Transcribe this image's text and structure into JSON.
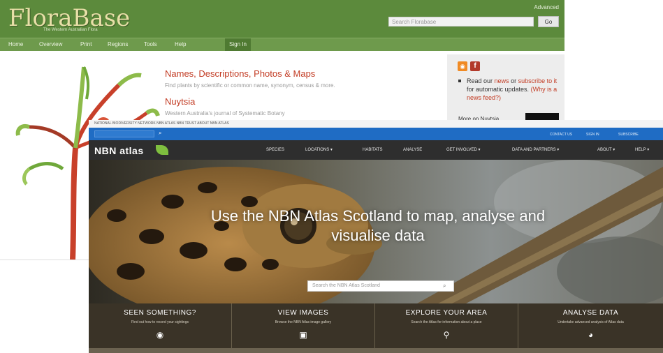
{
  "florabase": {
    "logo": "FloraBase",
    "tagline": "The Western Australian Flora",
    "advanced_label": "Advanced",
    "search_placeholder": "Search Florabase",
    "go_label": "Go",
    "nav": [
      "Home",
      "Overview",
      "Print",
      "Regions",
      "Tools",
      "Help",
      "Sign In"
    ],
    "heading1": "Names, Descriptions, Photos & Maps",
    "subtext1": "Find plants by scientific or common name, synonym, census & more.",
    "heading2": "Nuytsia",
    "subtext2": "Western Australia's journal of Systematic Botany",
    "news_pre": "Read our",
    "news_link1": "news",
    "news_mid": "or",
    "news_link2": "subscribe to it",
    "news_post": "for automatic updates.",
    "news_link3": "(Why is a news feed?)",
    "more": "More on Nuytsia"
  },
  "nbn": {
    "topbar_text": "NATIONAL BIODIVERSITY NETWORK    NBN ATLAS    NBN TRUST    ABOUT NBN ATLAS",
    "bluebar_links": [
      "CONTACT US",
      "SIGN IN",
      "SUBSCRIBE"
    ],
    "logo": "NBN atlas",
    "nav": [
      "SPECIES",
      "LOCATIONS ▾",
      "HABITATS",
      "ANALYSE",
      "GET INVOLVED ▾",
      "DATA AND PARTNERS ▾",
      "ABOUT ▾",
      "HELP ▾"
    ],
    "headline": "Use the NBN Atlas Scotland to map, analyse and visualise data",
    "search_placeholder": "Search the NBN Atlas Scotland",
    "tiles": [
      {
        "title": "SEEN SOMETHING?",
        "sub": "Find out how to record your sightings",
        "icon": "camera-icon",
        "glyph": "◉"
      },
      {
        "title": "VIEW IMAGES",
        "sub": "Browse the NBN Atlas image gallery",
        "icon": "image-icon",
        "glyph": "▣"
      },
      {
        "title": "EXPLORE YOUR AREA",
        "sub": "Search the Atlas for information about a place",
        "icon": "map-pin-icon",
        "glyph": "⚲"
      },
      {
        "title": "ANALYSE DATA",
        "sub": "Undertake advanced analysis of Atlas data",
        "icon": "pie-chart-icon",
        "glyph": "◕"
      }
    ]
  },
  "colors": {
    "florabase_green": "#5c8a3c",
    "florabase_red": "#c23a22",
    "nbn_blue": "#1f6cc4",
    "nbn_dark": "#2e2e2e"
  }
}
